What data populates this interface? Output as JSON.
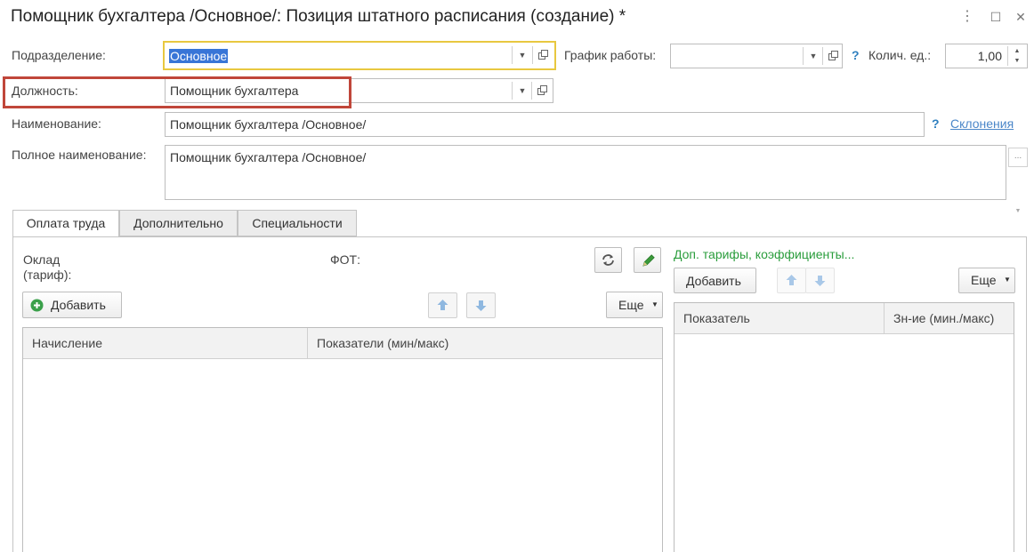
{
  "window": {
    "title": "Помощник бухгалтера /Основное/: Позиция штатного расписания (создание) *",
    "more_label": "⋮",
    "maximize_label": "☐",
    "close_label": "✕"
  },
  "form": {
    "subdivision": {
      "label": "Подразделение:",
      "value": "Основное"
    },
    "schedule": {
      "label": "График работы:",
      "value": ""
    },
    "help_mark": "?",
    "units": {
      "label": "Колич. ед.:",
      "value": "1,00"
    },
    "position": {
      "label": "Должность:",
      "value": "Помощник бухгалтера"
    },
    "name": {
      "label": "Наименование:",
      "value": "Помощник бухгалтера /Основное/"
    },
    "declensions_link": "Склонения",
    "full_name": {
      "label": "Полное наименование:",
      "value": "Помощник бухгалтера /Основное/"
    },
    "full_name_more": "..."
  },
  "tabs": [
    {
      "label": "Оплата труда",
      "active": true
    },
    {
      "label": "Дополнительно",
      "active": false
    },
    {
      "label": "Специальности",
      "active": false
    }
  ],
  "pay": {
    "salary_label": "Оклад\n(тариф):",
    "fot_label": "ФОТ:",
    "add_label": "Добавить",
    "more_label": "Еще",
    "columns": [
      "Начисление",
      "Показатели (мин/макс)"
    ]
  },
  "extra": {
    "title": "Доп. тарифы, коэффициенты...",
    "add_label": "Добавить",
    "more_label": "Еще",
    "columns": [
      "Показатель",
      "Зн-ие (мин./макс)"
    ]
  },
  "colors": {
    "accent_green": "#2a9d3c",
    "highlight": "#c0463a",
    "focus_border": "#e8c840",
    "selection": "#3875d7"
  }
}
